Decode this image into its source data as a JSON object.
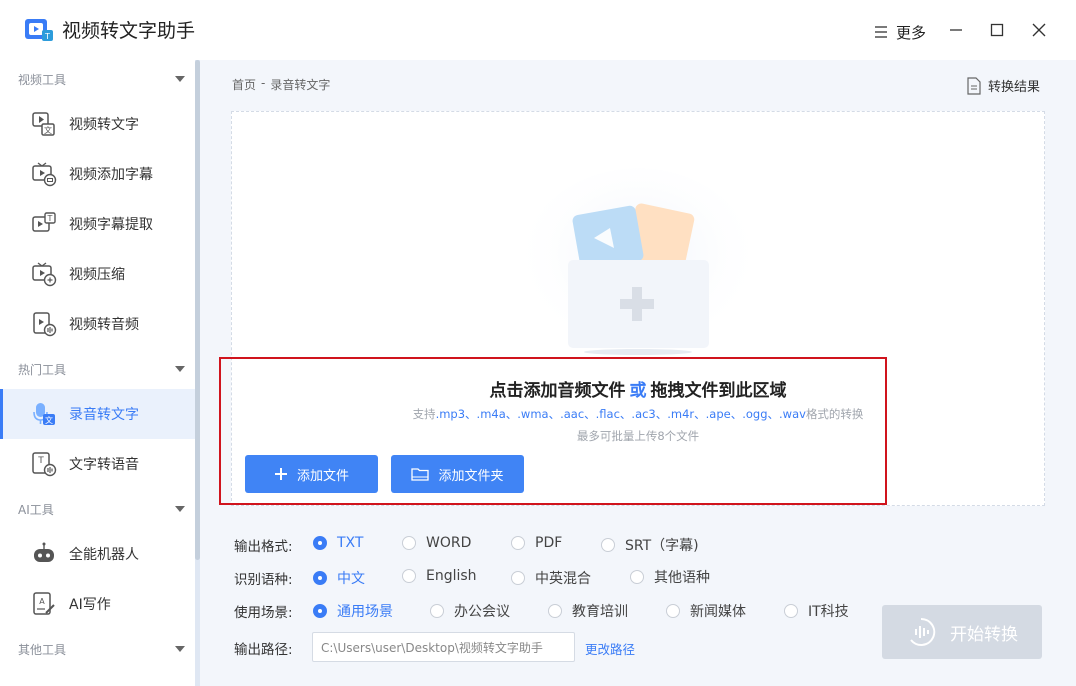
{
  "app": {
    "title": "视频转文字助手"
  },
  "titlebar": {
    "more_label": "更多"
  },
  "sidebar": {
    "sections": [
      {
        "label": "视频工具",
        "items": [
          "视频转文字",
          "视频添加字幕",
          "视频字幕提取",
          "视频压缩",
          "视频转音频"
        ]
      },
      {
        "label": "热门工具",
        "items": [
          "录音转文字",
          "文字转语音"
        ]
      },
      {
        "label": "AI工具",
        "items": [
          "全能机器人",
          "AI写作"
        ]
      },
      {
        "label": "其他工具",
        "items": []
      }
    ],
    "active_item": "录音转文字"
  },
  "breadcrumb": {
    "home": "首页",
    "sep": "-",
    "current": "录音转文字"
  },
  "result_button": {
    "label": "转换结果"
  },
  "dropzone": {
    "title_prefix": "点击添加音频文件",
    "title_or": "或",
    "title_suffix": "拖拽文件到此区域",
    "formats_prefix": "支持",
    "formats": ".mp3、.m4a、.wma、.aac、.flac、.ac3、.m4r、.ape、.ogg、.wav",
    "formats_suffix": "格式的转换",
    "limit": "最多可批量上传8个文件",
    "add_file_label": "添加文件",
    "add_folder_label": "添加文件夹"
  },
  "options": {
    "format": {
      "label": "输出格式:",
      "choices": [
        "TXT",
        "WORD",
        "PDF",
        "SRT（字幕)"
      ],
      "selected": "TXT"
    },
    "language": {
      "label": "识别语种:",
      "choices": [
        "中文",
        "English",
        "中英混合",
        "其他语种"
      ],
      "selected": "中文"
    },
    "scene": {
      "label": "使用场景:",
      "choices": [
        "通用场景",
        "办公会议",
        "教育培训",
        "新闻媒体",
        "IT科技"
      ],
      "selected": "通用场景"
    },
    "path": {
      "label": "输出路径:",
      "value": "C:\\Users\\user\\Desktop\\视频转文字助手",
      "change_label": "更改路径"
    }
  },
  "start_button": {
    "label": "开始转换"
  },
  "colors": {
    "accent": "#3a7cf6",
    "button": "#4084f5",
    "highlight": "#d0141d",
    "disabled": "#d4dae3"
  }
}
